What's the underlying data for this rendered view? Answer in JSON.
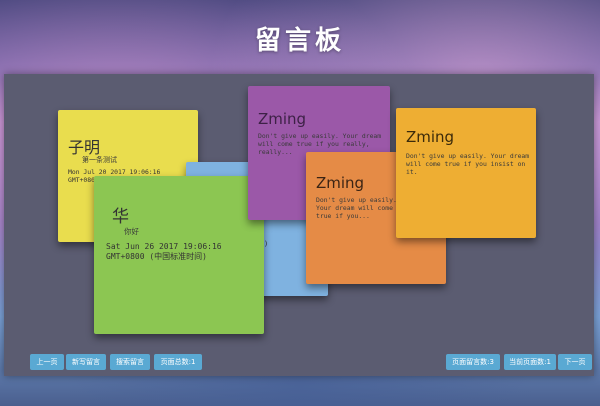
{
  "page": {
    "title": "留言板"
  },
  "notes": {
    "yellow": {
      "author": "子明",
      "message": "第一条测试",
      "time_line1": "Mon Jul 20 2017 19:06:16",
      "time_line2": "GMT+0800 (中国标准时间)",
      "color": "#e9dd4e"
    },
    "blue": {
      "time_fragment": ")",
      "color": "#7fb2e0"
    },
    "green": {
      "author": "华",
      "message": "你好",
      "time_line1": "Sat Jun 26 2017 19:06:16",
      "time_line2": "GMT+0800 (中国标准时间)",
      "color": "#8cc652"
    },
    "purple": {
      "author": "Zming",
      "message": "Don't give up easily. Your dream will come true if you really, really...",
      "color": "#9b58a8"
    },
    "orange_dark": {
      "author": "Zming",
      "message": "Don't give up easily. Your dream will come true if you...",
      "color": "#e58b46"
    },
    "orange_light": {
      "author": "Zming",
      "message": "Don't give up easily. Your dream will come true if you insist on it.",
      "color": "#eeae33"
    }
  },
  "toolbar": {
    "prev_label": "上一页",
    "new_note_label": "新写留言",
    "search_label": "搜索留言",
    "page_total_label": "页面总数:1",
    "notes_per_page_label": "页面留言数:3",
    "current_page_label": "当前页面数:1",
    "next_label": "下一页",
    "button_color": "#5aa9d3"
  }
}
